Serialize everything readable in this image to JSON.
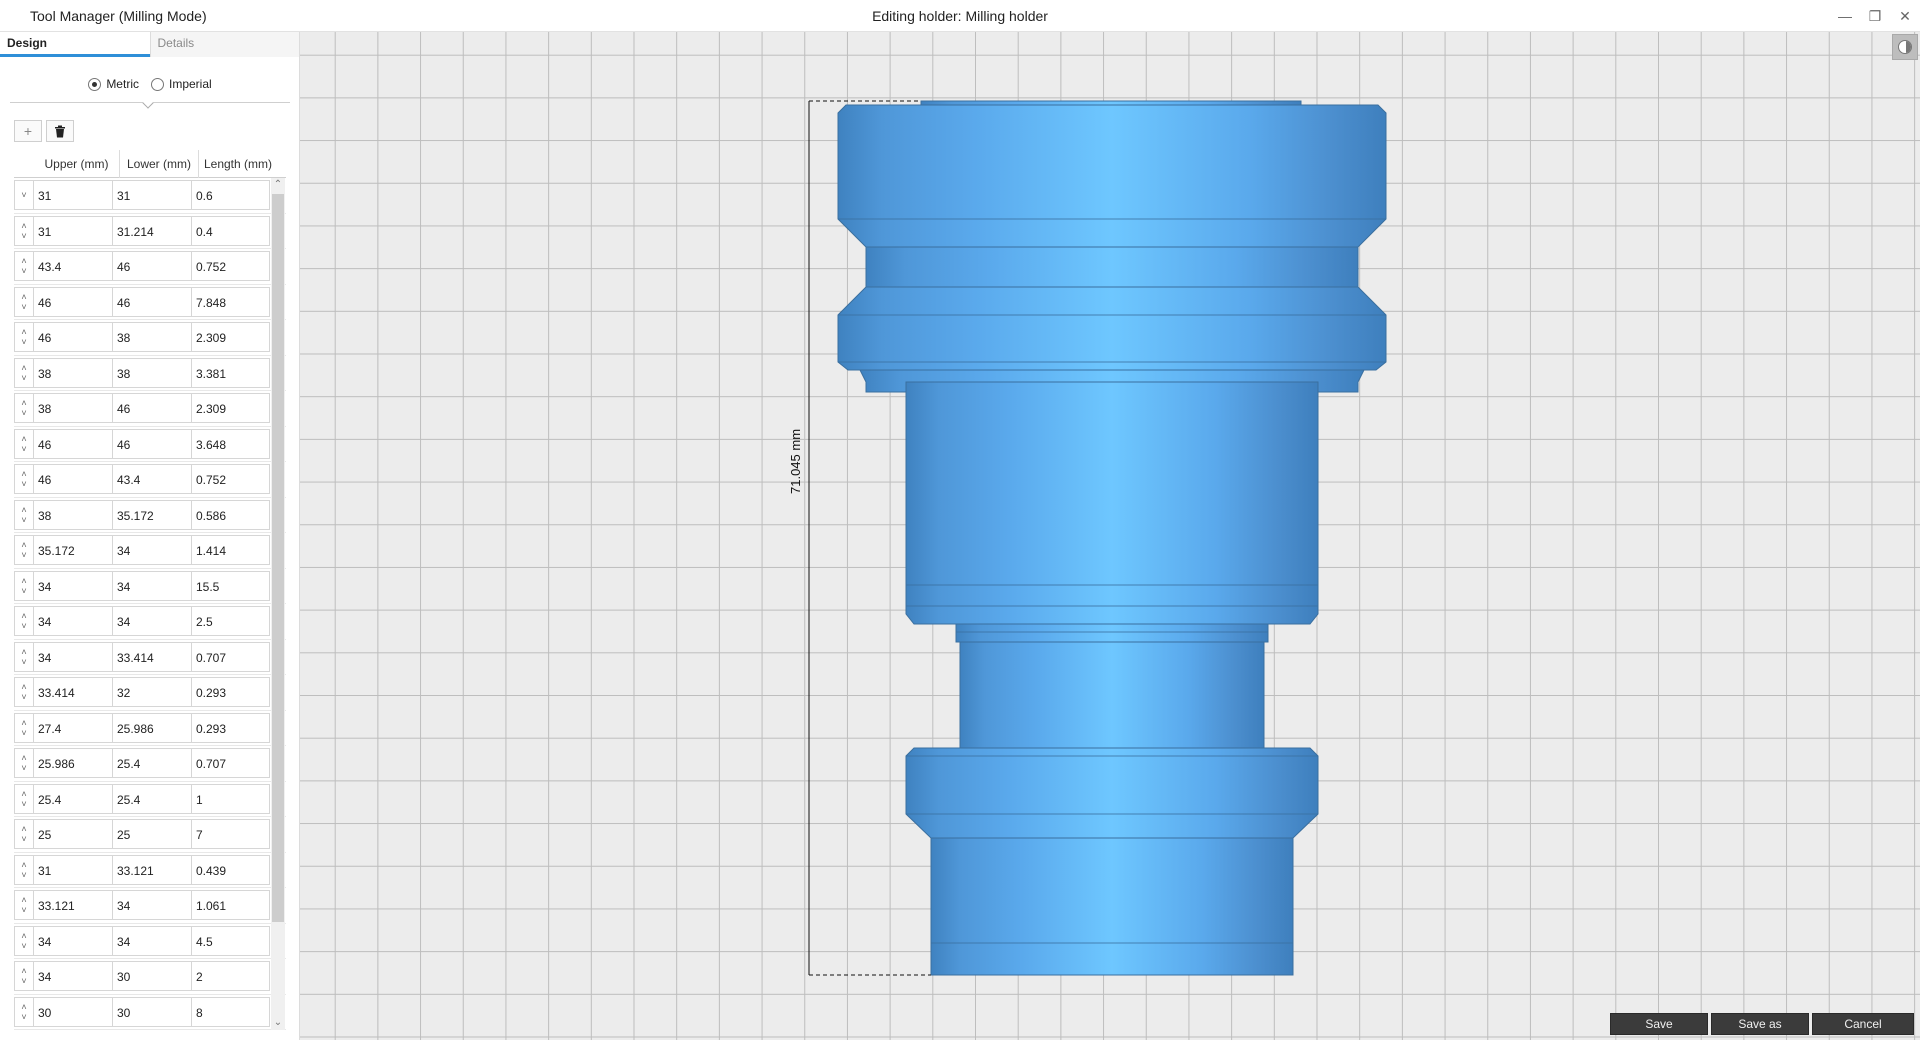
{
  "window": {
    "app_title": "Tool Manager (Milling Mode)",
    "editing_title": "Editing holder: Milling holder",
    "controls": [
      "minimize-icon",
      "restore-icon",
      "close-icon"
    ]
  },
  "tabs": [
    {
      "label": "Design",
      "active": true
    },
    {
      "label": "Details",
      "active": false
    }
  ],
  "units": {
    "selected": "Metric",
    "options": [
      "Metric",
      "Imperial"
    ]
  },
  "toolbar": {
    "add_icon": "plus-icon",
    "delete_icon": "trash-icon"
  },
  "table": {
    "columns": [
      "Upper  (mm)",
      "Lower   (mm)",
      "Length  (mm)"
    ],
    "rows": [
      [
        "31",
        "31",
        "0.6"
      ],
      [
        "31",
        "31.214",
        "0.4"
      ],
      [
        "43.4",
        "46",
        "0.752"
      ],
      [
        "46",
        "46",
        "7.848"
      ],
      [
        "46",
        "38",
        "2.309"
      ],
      [
        "38",
        "38",
        "3.381"
      ],
      [
        "38",
        "46",
        "2.309"
      ],
      [
        "46",
        "46",
        "3.648"
      ],
      [
        "46",
        "43.4",
        "0.752"
      ],
      [
        "38",
        "35.172",
        "0.586"
      ],
      [
        "35.172",
        "34",
        "1.414"
      ],
      [
        "34",
        "34",
        "15.5"
      ],
      [
        "34",
        "34",
        "2.5"
      ],
      [
        "34",
        "33.414",
        "0.707"
      ],
      [
        "33.414",
        "32",
        "0.293"
      ],
      [
        "27.4",
        "25.986",
        "0.293"
      ],
      [
        "25.986",
        "25.4",
        "0.707"
      ],
      [
        "25.4",
        "25.4",
        "1"
      ],
      [
        "25",
        "25",
        "7"
      ],
      [
        "31",
        "33.121",
        "0.439"
      ],
      [
        "33.121",
        "34",
        "1.061"
      ],
      [
        "34",
        "34",
        "4.5"
      ],
      [
        "34",
        "30",
        "2"
      ],
      [
        "30",
        "30",
        "8"
      ]
    ]
  },
  "viewport": {
    "dimension_label": "71.045 mm",
    "model_color": "#5aa8e8",
    "background_color": "#ececec"
  },
  "actions": {
    "save": "Save",
    "save_as": "Save as",
    "cancel": "Cancel"
  }
}
